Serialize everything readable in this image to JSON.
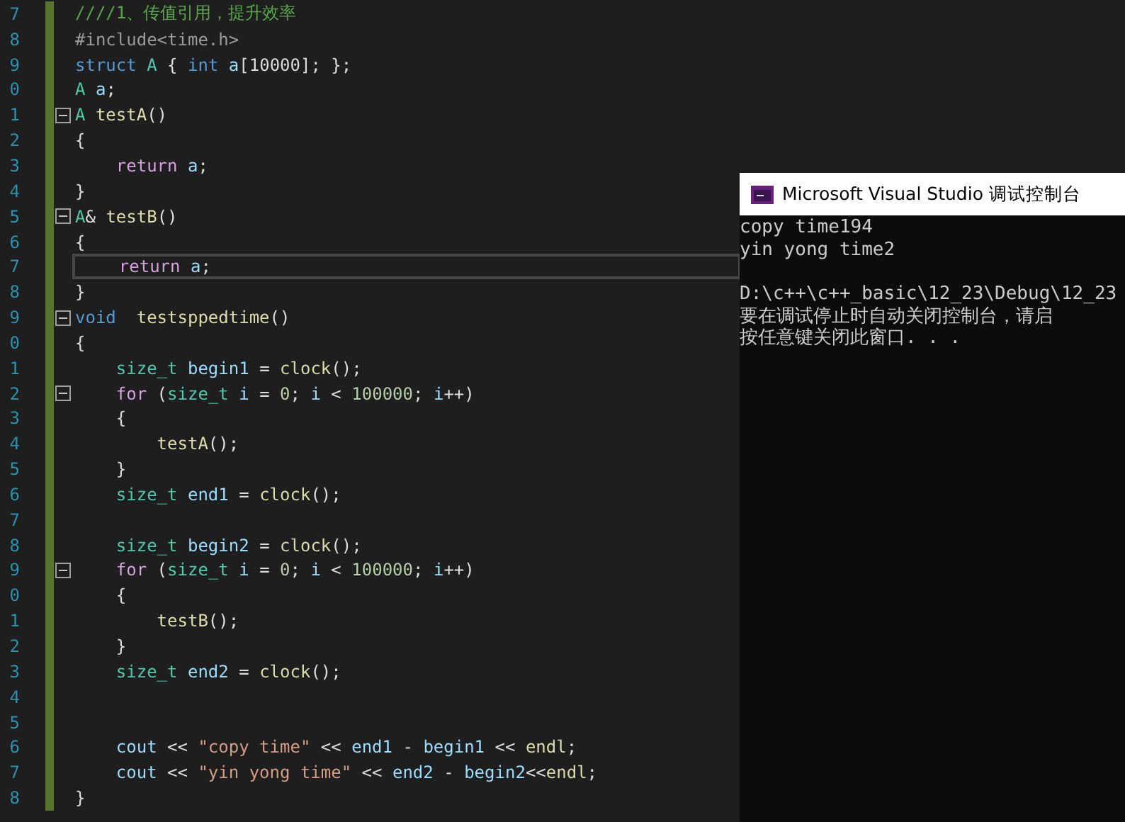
{
  "editor": {
    "lines": [
      {
        "number": "7",
        "fold": false,
        "current": false,
        "tokens": [
          {
            "t": "////1、传值引用，提升效率",
            "kind": "comment"
          }
        ]
      },
      {
        "number": "8",
        "fold": false,
        "current": false,
        "tokens": [
          {
            "t": "#include<time.h>",
            "kind": "preprocessor"
          }
        ]
      },
      {
        "number": "9",
        "fold": false,
        "current": false,
        "tokens": [
          {
            "t": "struct ",
            "kind": "keyword"
          },
          {
            "t": "A",
            "kind": "type"
          },
          {
            "t": " { ",
            "kind": "plain"
          },
          {
            "t": "int ",
            "kind": "keyword"
          },
          {
            "t": "a",
            "kind": "variable"
          },
          {
            "t": "[10000]; };",
            "kind": "plain"
          }
        ]
      },
      {
        "number": "0",
        "fold": false,
        "current": false,
        "tokens": [
          {
            "t": "A ",
            "kind": "type"
          },
          {
            "t": "a",
            "kind": "variable"
          },
          {
            "t": ";",
            "kind": "plain"
          }
        ]
      },
      {
        "number": "1",
        "fold": true,
        "current": false,
        "tokens": [
          {
            "t": "A ",
            "kind": "type"
          },
          {
            "t": "testA",
            "kind": "function"
          },
          {
            "t": "()",
            "kind": "plain"
          }
        ]
      },
      {
        "number": "2",
        "fold": false,
        "current": false,
        "tokens": [
          {
            "t": "{",
            "kind": "plain"
          }
        ]
      },
      {
        "number": "3",
        "fold": false,
        "current": false,
        "tokens": [
          {
            "t": "    return ",
            "kind": "control"
          },
          {
            "t": "a",
            "kind": "variable"
          },
          {
            "t": ";",
            "kind": "plain"
          }
        ]
      },
      {
        "number": "4",
        "fold": false,
        "current": false,
        "tokens": [
          {
            "t": "}",
            "kind": "plain"
          }
        ]
      },
      {
        "number": "5",
        "fold": true,
        "current": false,
        "tokens": [
          {
            "t": "A",
            "kind": "type"
          },
          {
            "t": "& ",
            "kind": "plain"
          },
          {
            "t": "testB",
            "kind": "function"
          },
          {
            "t": "()",
            "kind": "plain"
          }
        ]
      },
      {
        "number": "6",
        "fold": false,
        "current": false,
        "tokens": [
          {
            "t": "{",
            "kind": "plain"
          }
        ]
      },
      {
        "number": "7",
        "fold": false,
        "current": true,
        "tokens": [
          {
            "t": "    return ",
            "kind": "control"
          },
          {
            "t": "a",
            "kind": "variable"
          },
          {
            "t": ";",
            "kind": "plain"
          }
        ]
      },
      {
        "number": "8",
        "fold": false,
        "current": false,
        "tokens": [
          {
            "t": "}",
            "kind": "plain"
          }
        ]
      },
      {
        "number": "9",
        "fold": true,
        "current": false,
        "tokens": [
          {
            "t": "void  ",
            "kind": "keyword"
          },
          {
            "t": "testsppedtime",
            "kind": "function"
          },
          {
            "t": "()",
            "kind": "plain"
          }
        ]
      },
      {
        "number": "0",
        "fold": false,
        "current": false,
        "tokens": [
          {
            "t": "{",
            "kind": "plain"
          }
        ]
      },
      {
        "number": "1",
        "fold": false,
        "current": false,
        "tokens": [
          {
            "t": "    size_t ",
            "kind": "type"
          },
          {
            "t": "begin1",
            "kind": "variable"
          },
          {
            "t": " = ",
            "kind": "plain"
          },
          {
            "t": "clock",
            "kind": "function"
          },
          {
            "t": "();",
            "kind": "plain"
          }
        ]
      },
      {
        "number": "2",
        "fold": true,
        "current": false,
        "tokens": [
          {
            "t": "    for ",
            "kind": "control"
          },
          {
            "t": "(",
            "kind": "plain"
          },
          {
            "t": "size_t ",
            "kind": "type"
          },
          {
            "t": "i",
            "kind": "variable"
          },
          {
            "t": " = ",
            "kind": "plain"
          },
          {
            "t": "0",
            "kind": "number"
          },
          {
            "t": "; ",
            "kind": "plain"
          },
          {
            "t": "i",
            "kind": "variable"
          },
          {
            "t": " < ",
            "kind": "plain"
          },
          {
            "t": "100000",
            "kind": "number"
          },
          {
            "t": "; ",
            "kind": "plain"
          },
          {
            "t": "i",
            "kind": "variable"
          },
          {
            "t": "++)",
            "kind": "plain"
          }
        ]
      },
      {
        "number": "3",
        "fold": false,
        "current": false,
        "tokens": [
          {
            "t": "    {",
            "kind": "plain"
          }
        ]
      },
      {
        "number": "4",
        "fold": false,
        "current": false,
        "tokens": [
          {
            "t": "        testA",
            "kind": "function"
          },
          {
            "t": "();",
            "kind": "plain"
          }
        ]
      },
      {
        "number": "5",
        "fold": false,
        "current": false,
        "tokens": [
          {
            "t": "    }",
            "kind": "plain"
          }
        ]
      },
      {
        "number": "6",
        "fold": false,
        "current": false,
        "tokens": [
          {
            "t": "    size_t ",
            "kind": "type"
          },
          {
            "t": "end1",
            "kind": "variable"
          },
          {
            "t": " = ",
            "kind": "plain"
          },
          {
            "t": "clock",
            "kind": "function"
          },
          {
            "t": "();",
            "kind": "plain"
          }
        ]
      },
      {
        "number": "7",
        "fold": false,
        "current": false
      },
      {
        "number": "8",
        "fold": false,
        "current": false,
        "tokens": [
          {
            "t": "    size_t ",
            "kind": "type"
          },
          {
            "t": "begin2",
            "kind": "variable"
          },
          {
            "t": " = ",
            "kind": "plain"
          },
          {
            "t": "clock",
            "kind": "function"
          },
          {
            "t": "();",
            "kind": "plain"
          }
        ]
      },
      {
        "number": "9",
        "fold": true,
        "current": false,
        "tokens": [
          {
            "t": "    for ",
            "kind": "control"
          },
          {
            "t": "(",
            "kind": "plain"
          },
          {
            "t": "size_t ",
            "kind": "type"
          },
          {
            "t": "i",
            "kind": "variable"
          },
          {
            "t": " = ",
            "kind": "plain"
          },
          {
            "t": "0",
            "kind": "number"
          },
          {
            "t": "; ",
            "kind": "plain"
          },
          {
            "t": "i",
            "kind": "variable"
          },
          {
            "t": " < ",
            "kind": "plain"
          },
          {
            "t": "100000",
            "kind": "number"
          },
          {
            "t": "; ",
            "kind": "plain"
          },
          {
            "t": "i",
            "kind": "variable"
          },
          {
            "t": "++)",
            "kind": "plain"
          }
        ]
      },
      {
        "number": "0",
        "fold": false,
        "current": false,
        "tokens": [
          {
            "t": "    {",
            "kind": "plain"
          }
        ]
      },
      {
        "number": "1",
        "fold": false,
        "current": false,
        "tokens": [
          {
            "t": "        testB",
            "kind": "function"
          },
          {
            "t": "();",
            "kind": "plain"
          }
        ]
      },
      {
        "number": "2",
        "fold": false,
        "current": false,
        "tokens": [
          {
            "t": "    }",
            "kind": "plain"
          }
        ]
      },
      {
        "number": "3",
        "fold": false,
        "current": false,
        "tokens": [
          {
            "t": "    size_t ",
            "kind": "type"
          },
          {
            "t": "end2",
            "kind": "variable"
          },
          {
            "t": " = ",
            "kind": "plain"
          },
          {
            "t": "clock",
            "kind": "function"
          },
          {
            "t": "();",
            "kind": "plain"
          }
        ]
      },
      {
        "number": "4",
        "fold": false,
        "current": false
      },
      {
        "number": "5",
        "fold": false,
        "current": false
      },
      {
        "number": "6",
        "fold": false,
        "current": false,
        "tokens": [
          {
            "t": "    cout",
            "kind": "variable"
          },
          {
            "t": " << ",
            "kind": "plain"
          },
          {
            "t": "\"copy time\"",
            "kind": "string"
          },
          {
            "t": " << ",
            "kind": "plain"
          },
          {
            "t": "end1",
            "kind": "variable"
          },
          {
            "t": " - ",
            "kind": "plain"
          },
          {
            "t": "begin1",
            "kind": "variable"
          },
          {
            "t": " << ",
            "kind": "plain"
          },
          {
            "t": "endl",
            "kind": "function"
          },
          {
            "t": ";",
            "kind": "plain"
          }
        ]
      },
      {
        "number": "7",
        "fold": false,
        "current": false,
        "tokens": [
          {
            "t": "    cout",
            "kind": "variable"
          },
          {
            "t": " << ",
            "kind": "plain"
          },
          {
            "t": "\"yin yong time\"",
            "kind": "string"
          },
          {
            "t": " << ",
            "kind": "plain"
          },
          {
            "t": "end2",
            "kind": "variable"
          },
          {
            "t": " - ",
            "kind": "plain"
          },
          {
            "t": "begin2",
            "kind": "variable"
          },
          {
            "t": "<<",
            "kind": "plain"
          },
          {
            "t": "endl",
            "kind": "function"
          },
          {
            "t": ";",
            "kind": "plain"
          }
        ]
      },
      {
        "number": "8",
        "fold": false,
        "current": false,
        "tokens": [
          {
            "t": "}",
            "kind": "plain"
          }
        ]
      }
    ]
  },
  "console": {
    "title": "Microsoft Visual Studio 调试控制台",
    "lines": [
      {
        "text": "copy time194",
        "space_before": false
      },
      {
        "text": "yin yong time2",
        "space_before": false
      },
      {
        "text": "D:\\c++\\c++_basic\\12_23\\Debug\\12_23",
        "space_before": true
      },
      {
        "text": "要在调试停止时自动关闭控制台，请启",
        "space_before": false
      },
      {
        "text": "按任意键关闭此窗口. . .",
        "space_before": false
      }
    ]
  }
}
